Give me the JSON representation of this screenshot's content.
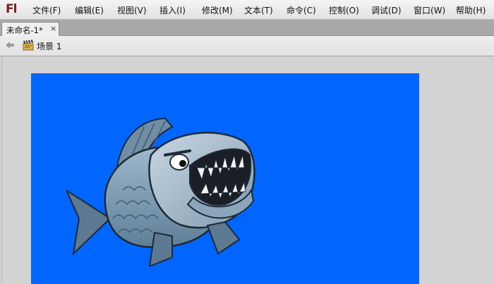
{
  "app": {
    "logo": "Fl"
  },
  "menu": {
    "items": [
      {
        "label": "文件(F)"
      },
      {
        "label": "编辑(E)"
      },
      {
        "label": "视图(V)"
      },
      {
        "label": "插入(I)"
      },
      {
        "label": "修改(M)"
      },
      {
        "label": "文本(T)"
      },
      {
        "label": "命令(C)"
      },
      {
        "label": "控制(O)"
      },
      {
        "label": "调试(D)"
      },
      {
        "label": "窗口(W)"
      },
      {
        "label": "帮助(H)"
      }
    ]
  },
  "tabs": [
    {
      "label": "未命名-1*",
      "close": "×"
    }
  ],
  "editbar": {
    "back_icon": "back-arrow-icon",
    "scene_icon": "clapperboard-icon",
    "scene_label": "场景 1"
  },
  "stage": {
    "background_color": "#0066ff",
    "artwork": "piranha-fish-illustration"
  }
}
